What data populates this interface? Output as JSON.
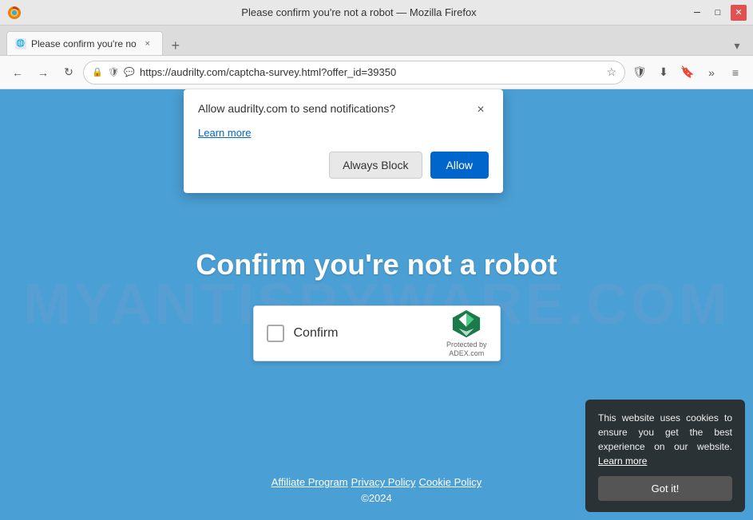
{
  "browser": {
    "title": "Please confirm you're not a robot — Mozilla Firefox",
    "tab": {
      "favicon_label": "🌐",
      "title": "Please confirm you're no",
      "close_label": "×"
    },
    "tab_new_label": "+",
    "tab_dropdown_label": "▾",
    "nav": {
      "back_label": "←",
      "forward_label": "→",
      "reload_label": "↻",
      "url": "https://audrilty.com/captcha-survey.html?offer_id=39350",
      "star_label": "☆",
      "shield_label": "🛡",
      "download_label": "⬇",
      "bookmark_label": "🔖",
      "overflow_label": "»",
      "menu_label": "≡"
    }
  },
  "notification_popup": {
    "title": "Allow audrilty.com to send notifications?",
    "learn_more_label": "Learn more",
    "close_label": "×",
    "always_block_label": "Always Block",
    "allow_label": "Allow"
  },
  "page": {
    "heading": "Confirm you're not a robot",
    "captcha": {
      "label": "Confirm",
      "logo_line1": "Protected by",
      "logo_line2": "ADEX.com"
    },
    "footer": {
      "affiliate_label": "Affiliate Program",
      "privacy_label": "Privacy Policy",
      "cookie_label": "Cookie Policy",
      "copyright": "©2024"
    }
  },
  "watermark": {
    "text": "MYANTISPYWARE.COM"
  },
  "cookie_consent": {
    "text": "This website uses cookies to ensure you get the best experience on our website.",
    "learn_more_label": "Learn more",
    "got_it_label": "Got it!"
  }
}
